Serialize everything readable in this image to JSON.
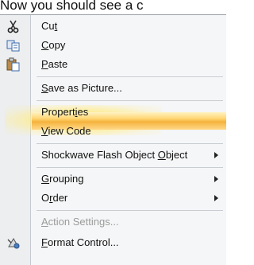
{
  "caption": "Now you should see a c",
  "menu": {
    "items": [
      {
        "label": "Cut",
        "underline_index": 2,
        "icon": "scissors-icon",
        "disabled": false,
        "submenu": false
      },
      {
        "label": "Copy",
        "underline_index": 0,
        "icon": "copy-icon",
        "disabled": false,
        "submenu": false
      },
      {
        "label": "Paste",
        "underline_index": 0,
        "icon": "paste-icon",
        "disabled": false,
        "submenu": false
      },
      {
        "label": "Save as Picture...",
        "underline_index": 0,
        "icon": "",
        "disabled": false,
        "submenu": false
      },
      {
        "label": "Properties",
        "underline_index": 7,
        "icon": "",
        "disabled": false,
        "submenu": false,
        "highlighted": true
      },
      {
        "label": "View Code",
        "underline_index": 0,
        "icon": "",
        "disabled": false,
        "submenu": false
      },
      {
        "label": "Shockwave Flash Object Object",
        "underline_index": 23,
        "icon": "",
        "disabled": false,
        "submenu": true
      },
      {
        "label": "Grouping",
        "underline_index": 0,
        "icon": "",
        "disabled": false,
        "submenu": true
      },
      {
        "label": "Order",
        "underline_index": 1,
        "icon": "",
        "disabled": false,
        "submenu": true
      },
      {
        "label": "Action Settings...",
        "underline_index": 0,
        "icon": "",
        "disabled": true,
        "submenu": false
      },
      {
        "label": "Format Control...",
        "underline_index": 0,
        "icon": "format-control-icon",
        "disabled": false,
        "submenu": false
      }
    ]
  }
}
